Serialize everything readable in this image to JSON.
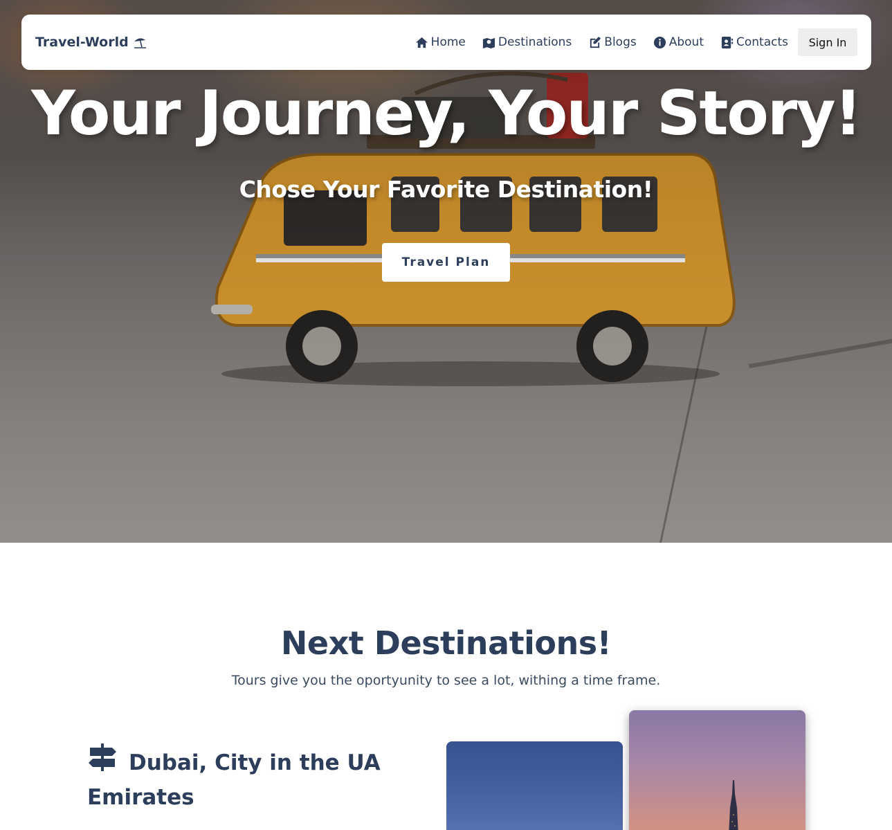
{
  "navbar": {
    "brand": "Travel-World",
    "items": [
      {
        "label": "Home",
        "icon": "home-icon"
      },
      {
        "label": "Destinations",
        "icon": "map-icon"
      },
      {
        "label": "Blogs",
        "icon": "edit-icon"
      },
      {
        "label": "About",
        "icon": "info-icon"
      },
      {
        "label": "Contacts",
        "icon": "contact-book-icon"
      }
    ],
    "signin_label": "Sign In"
  },
  "hero": {
    "title": "Your Journey, Your Story!",
    "subtitle": "Chose Your Favorite Destination!",
    "button_label": "Travel Plan"
  },
  "section": {
    "title": "Next Destinations!",
    "subtitle": "Tours give you the oportyunity to see a lot, withing a time frame."
  },
  "destination": {
    "title": "Dubai, City in the UA Emirates",
    "icon": "signpost-icon"
  },
  "colors": {
    "primary_text": "#2c3e5c",
    "navbar_bg": "#ffffff",
    "signin_bg": "#eeeeee"
  }
}
